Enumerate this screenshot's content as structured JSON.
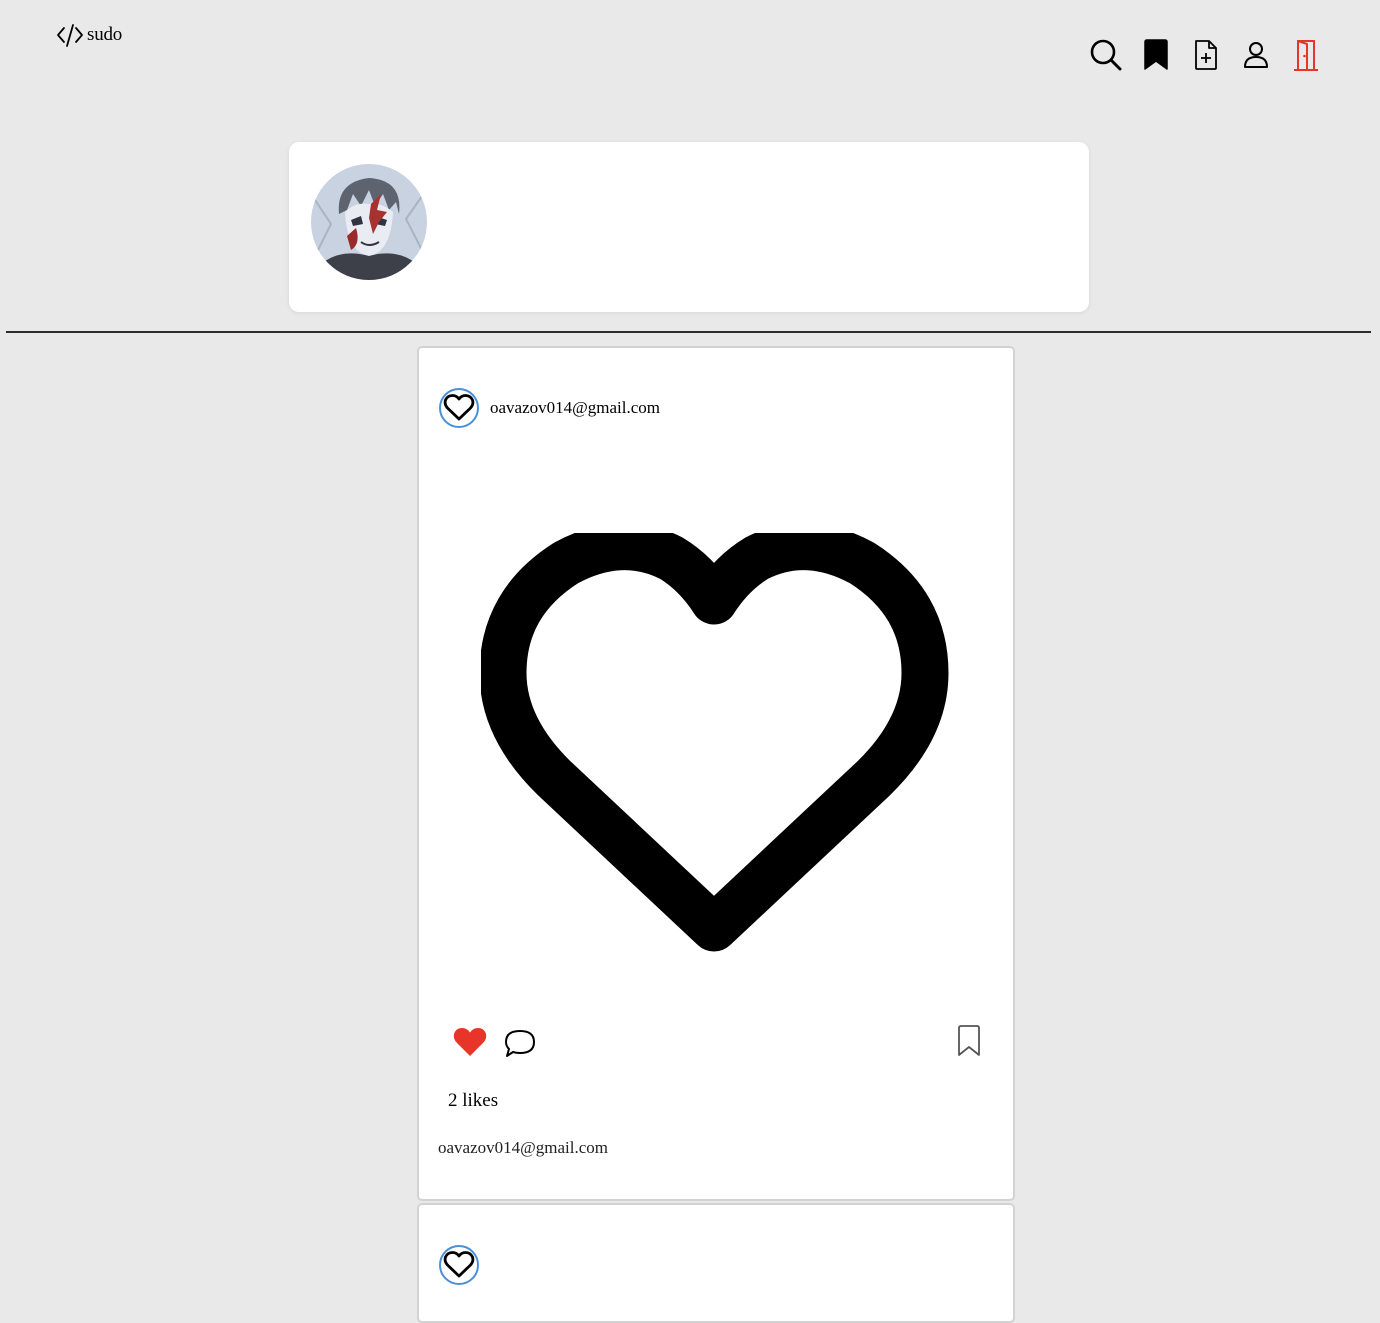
{
  "header": {
    "logo_text": "sudo",
    "logo_icon": "code-brackets-icon",
    "nav": [
      {
        "name": "search",
        "icon": "search-icon"
      },
      {
        "name": "saved",
        "icon": "bookmark-icon"
      },
      {
        "name": "new-post",
        "icon": "file-plus-icon"
      },
      {
        "name": "profile",
        "icon": "user-icon"
      },
      {
        "name": "logout",
        "icon": "door-icon",
        "color": "#e8352a"
      }
    ]
  },
  "profile": {
    "avatar": "anime-character-avatar"
  },
  "posts": [
    {
      "author": "oavazov014@gmail.com",
      "avatar_icon": "heart-outline-icon",
      "image_icon": "heart-outline-icon",
      "liked": true,
      "like_color": "#e8352a",
      "likes_text": "2 likes",
      "caption": "oavazov014@gmail.com"
    },
    {
      "avatar_icon": "heart-outline-icon"
    }
  ]
}
